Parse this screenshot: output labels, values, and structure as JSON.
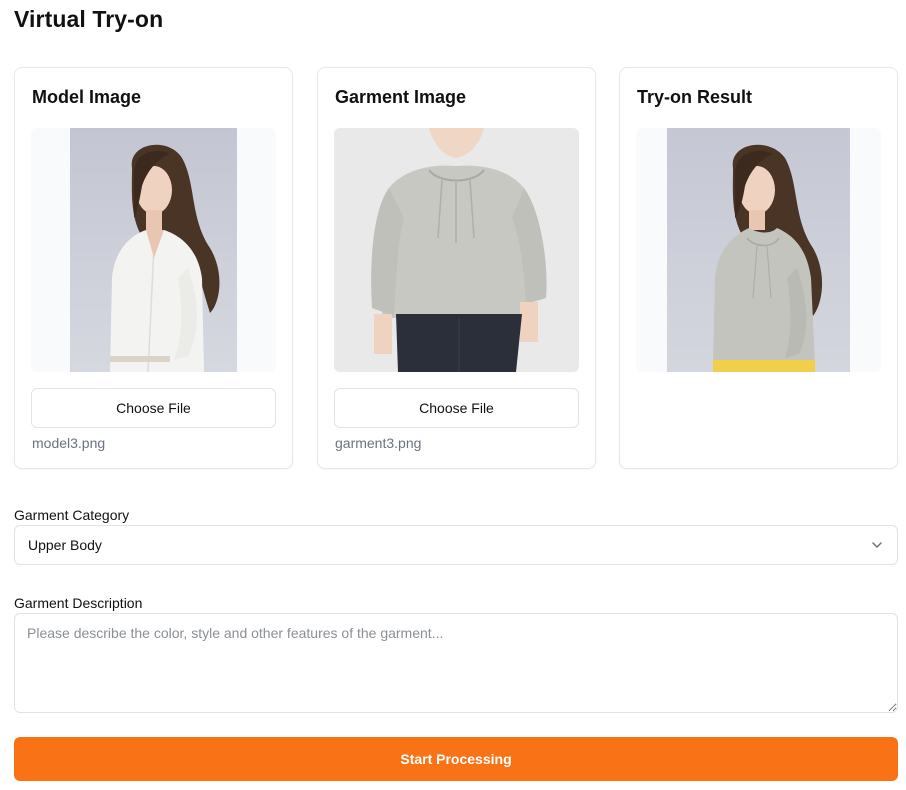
{
  "page": {
    "title": "Virtual Try-on"
  },
  "cards": {
    "model": {
      "title": "Model Image",
      "button_label": "Choose File",
      "file_name": "model3.png"
    },
    "garment": {
      "title": "Garment Image",
      "button_label": "Choose File",
      "file_name": "garment3.png"
    },
    "result": {
      "title": "Try-on Result"
    }
  },
  "category": {
    "label": "Garment Category",
    "selected": "Upper Body"
  },
  "description": {
    "label": "Garment Description",
    "placeholder": "Please describe the color, style and other features of the garment...",
    "value": ""
  },
  "actions": {
    "start_label": "Start Processing"
  },
  "colors": {
    "accent": "#f97316",
    "border": "#e5e7eb",
    "muted_text": "#6b7280"
  }
}
